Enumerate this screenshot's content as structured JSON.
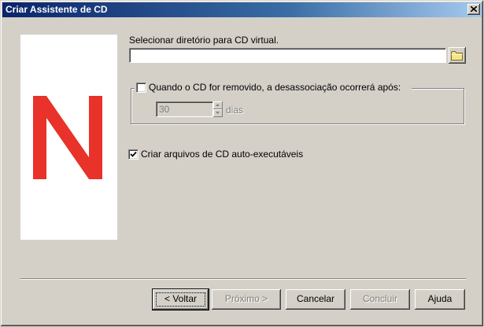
{
  "window": {
    "title": "Criar Assistente de CD"
  },
  "brand": {
    "logo_letter_color": "#e8322a"
  },
  "directory": {
    "label": "Selecionar diretório para CD virtual.",
    "value": ""
  },
  "disassociate": {
    "checked": false,
    "label": "Quando o CD for removido, a desassociação ocorrerá após:",
    "days_value": "30",
    "days_unit": "dias"
  },
  "autorun": {
    "checked": true,
    "label": "Criar arquivos de CD auto-executáveis"
  },
  "buttons": {
    "back": "< Voltar",
    "next": "Próximo >",
    "cancel": "Cancelar",
    "finish": "Concluir",
    "help": "Ajuda"
  }
}
